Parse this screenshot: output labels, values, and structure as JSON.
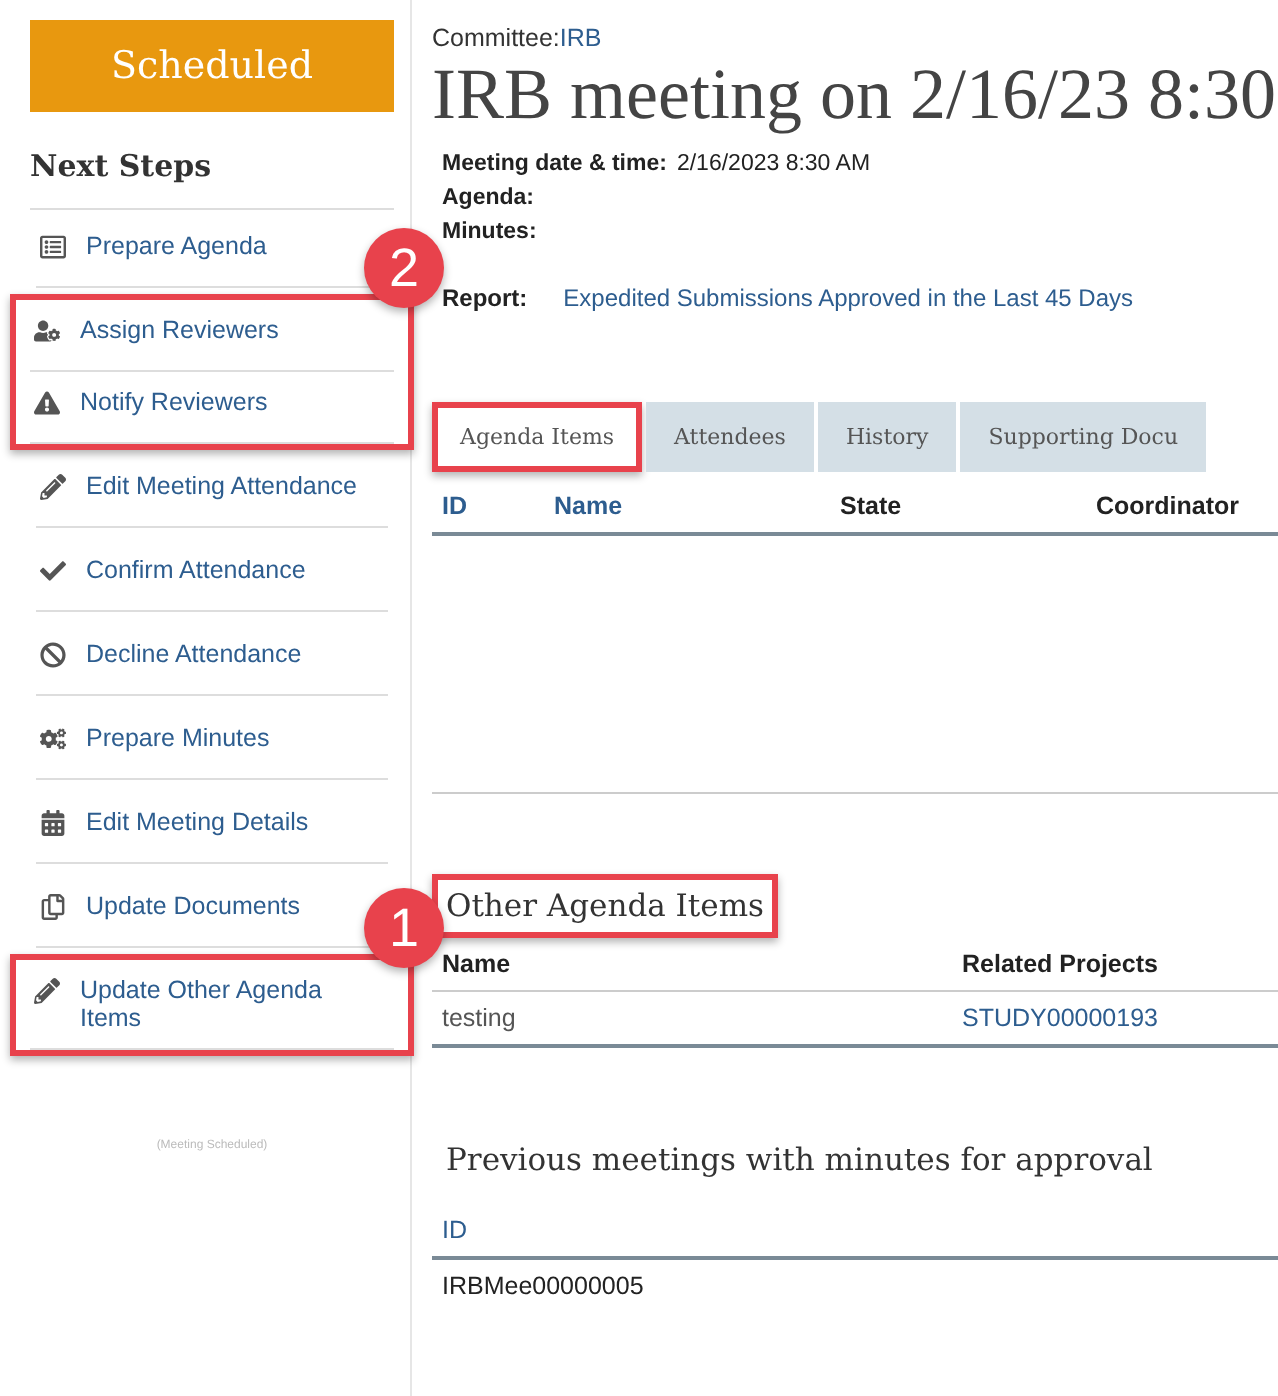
{
  "status_badge": "Scheduled",
  "next_steps": {
    "title": "Next Steps",
    "items": [
      {
        "label": "Prepare Agenda",
        "highlighted": false
      },
      {
        "label": "Assign Reviewers",
        "highlighted": true,
        "callout": "2"
      },
      {
        "label": "Notify Reviewers",
        "highlighted": true
      },
      {
        "label": "Edit Meeting Attendance",
        "highlighted": false
      },
      {
        "label": "Confirm Attendance",
        "highlighted": false
      },
      {
        "label": "Decline Attendance",
        "highlighted": false
      },
      {
        "label": "Prepare Minutes",
        "highlighted": false
      },
      {
        "label": "Edit Meeting Details",
        "highlighted": false
      },
      {
        "label": "Update Documents",
        "highlighted": false
      },
      {
        "label": "Update Other Agenda Items",
        "highlighted": true,
        "callout": "1"
      }
    ],
    "footer": "(Meeting Scheduled)"
  },
  "header": {
    "committee_label": "Committee:",
    "committee": "IRB",
    "title": "IRB meeting on 2/16/23 8:30",
    "fields": [
      {
        "label": "Meeting date & time:",
        "value": "2/16/2023 8:30 AM"
      },
      {
        "label": "Agenda:"
      },
      {
        "label": "Minutes:"
      }
    ],
    "report": {
      "label": "Report:",
      "link": "Expedited Submissions Approved in the Last 45 Days"
    }
  },
  "tabs": [
    {
      "label": "Agenda Items",
      "selected": true,
      "highlighted": true
    },
    {
      "label": "Attendees",
      "selected": false
    },
    {
      "label": "History",
      "selected": false
    },
    {
      "label": "Supporting Docu",
      "selected": false
    }
  ],
  "agenda_table": {
    "columns": [
      {
        "label": "ID",
        "link": true
      },
      {
        "label": "Name",
        "link": true
      },
      {
        "label": "State",
        "link": false
      },
      {
        "label": "Coordinator",
        "link": false
      }
    ]
  },
  "other_agenda": {
    "title": "Other Agenda Items",
    "highlighted": true,
    "columns": [
      "Name",
      "Related Projects"
    ],
    "rows": [
      {
        "name": "testing",
        "project": "STUDY00000193"
      }
    ]
  },
  "previous_meetings": {
    "title": "Previous meetings with minutes for approval",
    "columns": [
      "ID"
    ],
    "rows": [
      "IRBMee00000005"
    ]
  }
}
